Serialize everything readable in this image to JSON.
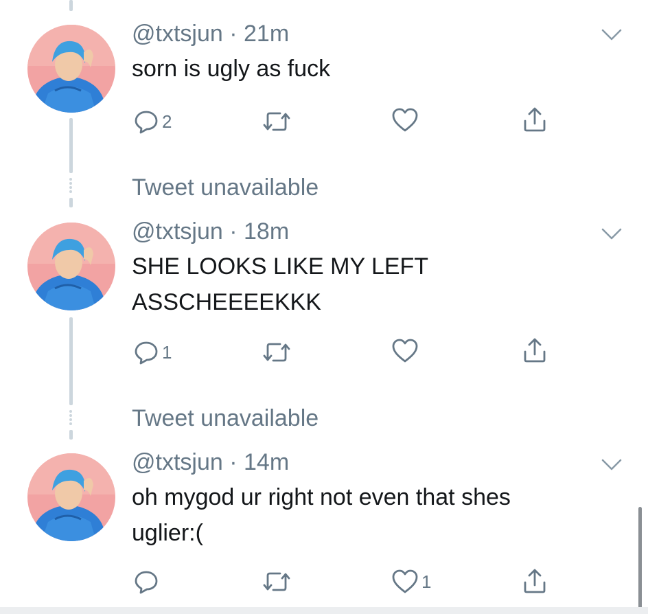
{
  "tweets": [
    {
      "handle": "@txtsjun",
      "time": "21m",
      "line1": "sorn is ugly as fuck",
      "line2": "",
      "replies": "2",
      "retweets": "",
      "likes": ""
    },
    {
      "handle": "@txtsjun",
      "time": "18m",
      "line1": "SHE LOOKS LIKE MY LEFT",
      "line2": "ASSCHEEEEKKK",
      "replies": "1",
      "retweets": "",
      "likes": ""
    },
    {
      "handle": "@txtsjun",
      "time": "14m",
      "line1": "oh mygod ur right not even that shes",
      "line2": "uglier:(",
      "replies": "",
      "retweets": "",
      "likes": "1"
    }
  ],
  "unavailable": [
    "Tweet unavailable",
    "Tweet unavailable"
  ],
  "separator": "·",
  "icons": {
    "reply": "reply-icon",
    "retweet": "retweet-icon",
    "like": "heart-icon",
    "share": "share-icon",
    "caret": "chevron-down-icon",
    "avatar": "profile-photo"
  },
  "colors": {
    "icon_gray": "#657786",
    "text": "#14171a",
    "thread_line": "#ccd6dd",
    "avatar_bg": "#f2a3a3",
    "hair": "#3ea0e0",
    "shirt": "#2f7fd6"
  }
}
